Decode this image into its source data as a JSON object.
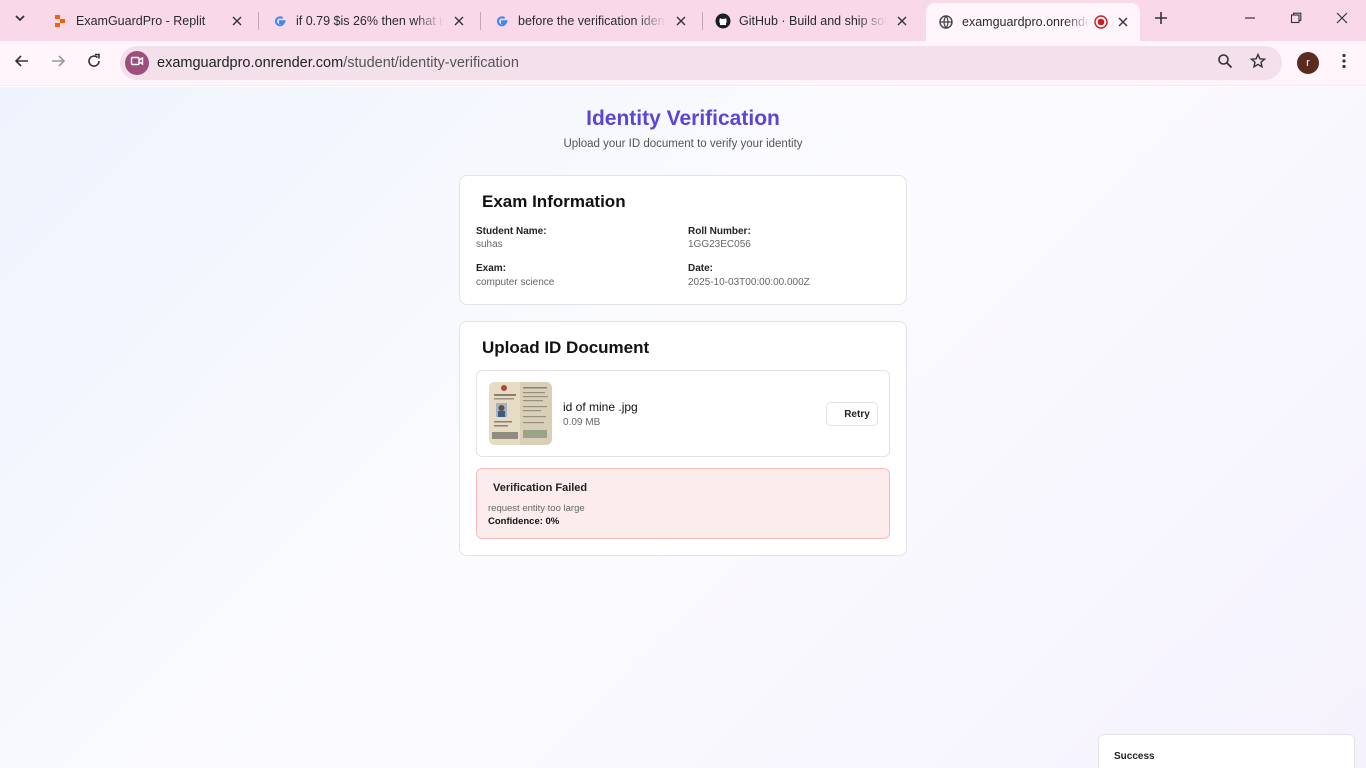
{
  "browser": {
    "tabs": [
      {
        "title": "ExamGuardPro - Replit",
        "favicon": "replit-icon"
      },
      {
        "title": "if 0.79 $is 26% then what is 1",
        "favicon": "google-icon"
      },
      {
        "title": "before the verification identi",
        "favicon": "google-icon"
      },
      {
        "title": "GitHub · Build and ship softw",
        "favicon": "github-icon"
      },
      {
        "title": "examguardpro.onrender",
        "favicon": "globe-icon",
        "active": true
      }
    ],
    "url_host": "examguardpro.onrender.com",
    "url_path": "/student/identity-verification",
    "profile_initial": "r"
  },
  "page": {
    "title": "Identity Verification",
    "subtitle": "Upload your ID document to verify your identity"
  },
  "exam_info": {
    "heading": "Exam Information",
    "student_name_label": "Student Name:",
    "student_name": "suhas",
    "roll_number_label": "Roll Number:",
    "roll_number": "1GG23EC056",
    "exam_label": "Exam:",
    "exam": "computer science",
    "date_label": "Date:",
    "date": "2025-10-03T00:00:00.000Z"
  },
  "upload": {
    "heading": "Upload ID Document",
    "file_name": "id of mine .jpg",
    "file_size": "0.09 MB",
    "retry_label": "Retry"
  },
  "verification": {
    "status_title": "Verification Failed",
    "message": "request entity too large",
    "confidence": "Confidence: 0%"
  },
  "toast": {
    "title": "Success"
  },
  "colors": {
    "title_accent": "#5b45d6",
    "error_bg": "#fdecec",
    "error_border": "#f6bcbc",
    "tab_strip": "#f9d9e9"
  }
}
